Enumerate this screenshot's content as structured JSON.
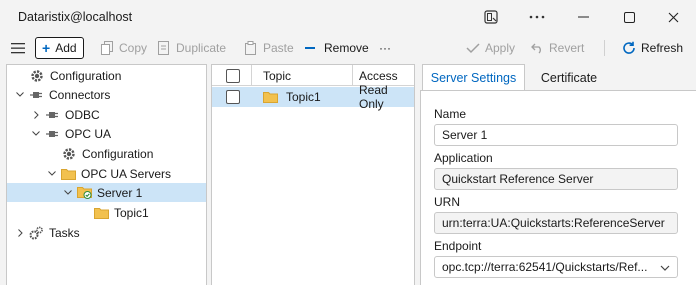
{
  "window": {
    "title": "Dataristix@localhost"
  },
  "toolbar": {
    "add": "Add",
    "copy": "Copy",
    "duplicate": "Duplicate",
    "paste": "Paste",
    "remove": "Remove",
    "more": "···",
    "apply": "Apply",
    "revert": "Revert",
    "refresh": "Refresh"
  },
  "tree": [
    {
      "label": "Configuration"
    },
    {
      "label": "Connectors"
    },
    {
      "label": "ODBC"
    },
    {
      "label": "OPC UA"
    },
    {
      "label": "Configuration"
    },
    {
      "label": "OPC UA Servers"
    },
    {
      "label": "Server 1"
    },
    {
      "label": "Topic1"
    },
    {
      "label": "Tasks"
    }
  ],
  "list": {
    "headers": {
      "topic": "Topic",
      "access": "Access"
    },
    "rows": [
      {
        "topic": "Topic1",
        "access": "Read Only"
      }
    ]
  },
  "tabs": {
    "server_settings": "Server Settings",
    "certificate": "Certificate"
  },
  "form": {
    "name_label": "Name",
    "name_value": "Server 1",
    "application_label": "Application",
    "application_value": "Quickstart Reference Server",
    "urn_label": "URN",
    "urn_value": "urn:terra:UA:Quickstarts:ReferenceServer",
    "endpoint_label": "Endpoint",
    "endpoint_value": "opc.tcp://terra:62541/Quickstarts/Ref..."
  },
  "colors": {
    "accent": "#0067c0",
    "selection": "#cce4f7",
    "folder": "#f2c14e",
    "remove": "#0067c0"
  }
}
